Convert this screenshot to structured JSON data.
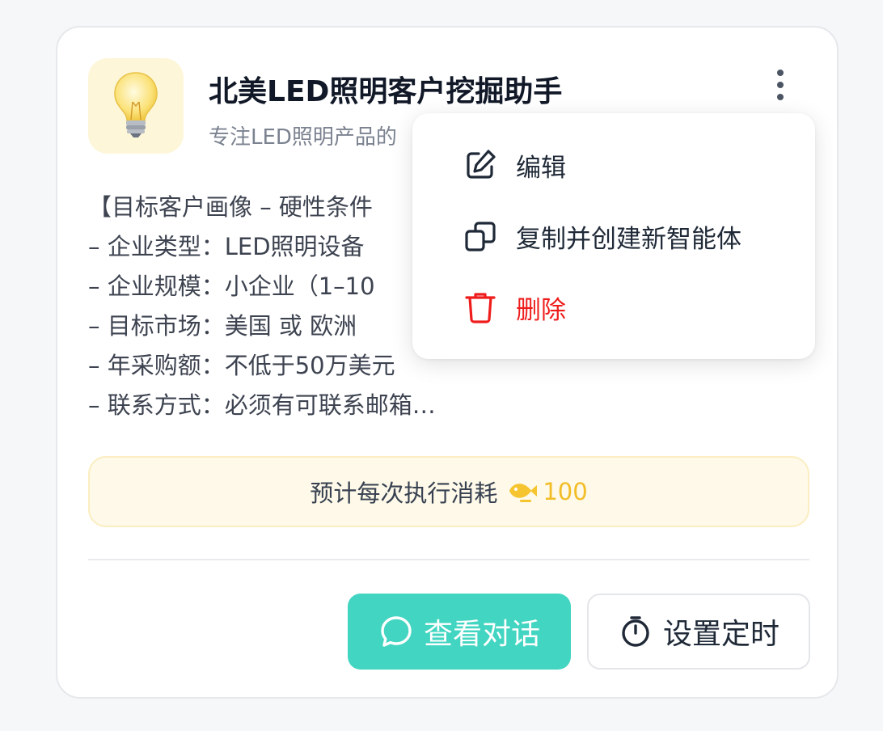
{
  "agent": {
    "icon": "lightbulb-icon",
    "title": "北美LED照明客户挖掘助手",
    "subtitle": "专注LED照明产品的",
    "description_lines": [
      "【目标客户画像 – 硬性条件",
      "– 企业类型：LED照明设备",
      "– 企业规模：小企业（1–10",
      "– 目标市场：美国 或 欧洲",
      "– 年采购额：不低于50万美元",
      "– 联系方式：必须有可联系邮箱…"
    ]
  },
  "cost": {
    "label": "预计每次执行消耗",
    "coin_icon": "fish-coin-icon",
    "amount": "100"
  },
  "buttons": {
    "chat": "查看对话",
    "timer": "设置定时"
  },
  "menu": {
    "items": [
      {
        "label": "编辑",
        "icon": "edit-icon"
      },
      {
        "label": "复制并创建新智能体",
        "icon": "copy-icon"
      },
      {
        "label": "删除",
        "icon": "trash-icon"
      }
    ]
  },
  "colors": {
    "accent": "#42d5c1",
    "danger": "#ef1c1c",
    "coin": "#f2bd27"
  }
}
